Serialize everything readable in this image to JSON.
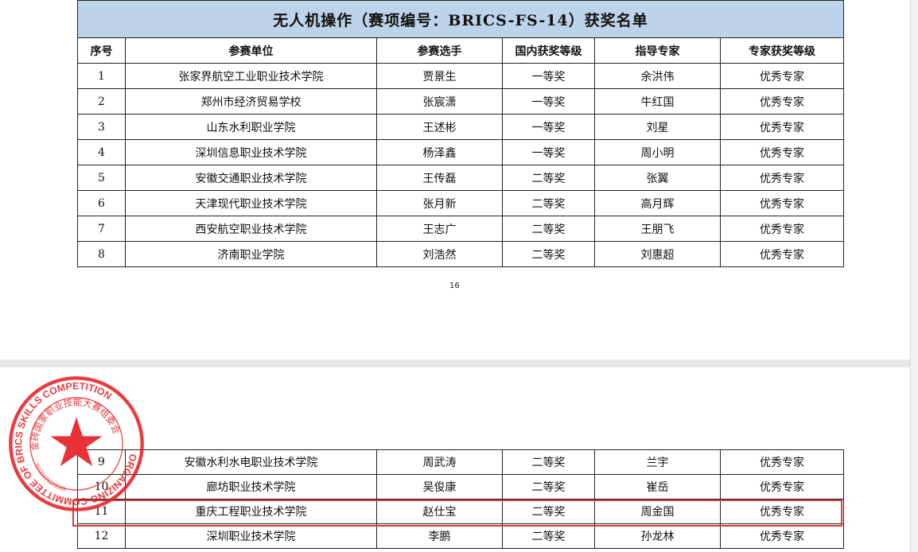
{
  "page1": {
    "title": "无人机操作（赛项编号：BRICS-FS-14）获奖名单",
    "headers": [
      "序号",
      "参赛单位",
      "参赛选手",
      "国内获奖等级",
      "指导专家",
      "专家获奖等级"
    ],
    "rows": [
      [
        "1",
        "张家界航空工业职业技术学院",
        "贾景生",
        "一等奖",
        "余洪伟",
        "优秀专家"
      ],
      [
        "2",
        "郑州市经济贸易学校",
        "张宸潇",
        "一等奖",
        "牛红国",
        "优秀专家"
      ],
      [
        "3",
        "山东水利职业学院",
        "王述彬",
        "一等奖",
        "刘星",
        "优秀专家"
      ],
      [
        "4",
        "深圳信息职业技术学院",
        "杨泽鑫",
        "一等奖",
        "周小明",
        "优秀专家"
      ],
      [
        "5",
        "安徽交通职业技术学院",
        "王传磊",
        "二等奖",
        "张翼",
        "优秀专家"
      ],
      [
        "6",
        "天津现代职业技术学院",
        "张月新",
        "二等奖",
        "高月辉",
        "优秀专家"
      ],
      [
        "7",
        "西安航空职业技术学院",
        "王志广",
        "二等奖",
        "王朋飞",
        "优秀专家"
      ],
      [
        "8",
        "济南职业学院",
        "刘浩然",
        "二等奖",
        "刘惠超",
        "优秀专家"
      ]
    ],
    "page_number": "16"
  },
  "page2": {
    "rows": [
      [
        "9",
        "安徽水利水电职业技术学院",
        "周武涛",
        "二等奖",
        "兰宇",
        "优秀专家"
      ],
      [
        "10",
        "廊坊职业技术学院",
        "吴俊康",
        "二等奖",
        "崔岳",
        "优秀专家"
      ],
      [
        "11",
        "重庆工程职业技术学院",
        "赵仕宝",
        "二等奖",
        "周金国",
        "优秀专家"
      ],
      [
        "12",
        "深圳职业技术学院",
        "李鹏",
        "二等奖",
        "孙龙林",
        "优秀专家"
      ]
    ],
    "highlighted_row": "11"
  },
  "seal": {
    "outer_text": "ORGANIZING COMMITTEE OF BRICS SKILLS COMPETITION",
    "inner_text": "金砖国家职业技能大赛组委会",
    "code": "35021101123533",
    "color": "#e8272b"
  },
  "colors": {
    "title_bg": "#bdd3ea",
    "highlight_border": "#d9393e"
  }
}
